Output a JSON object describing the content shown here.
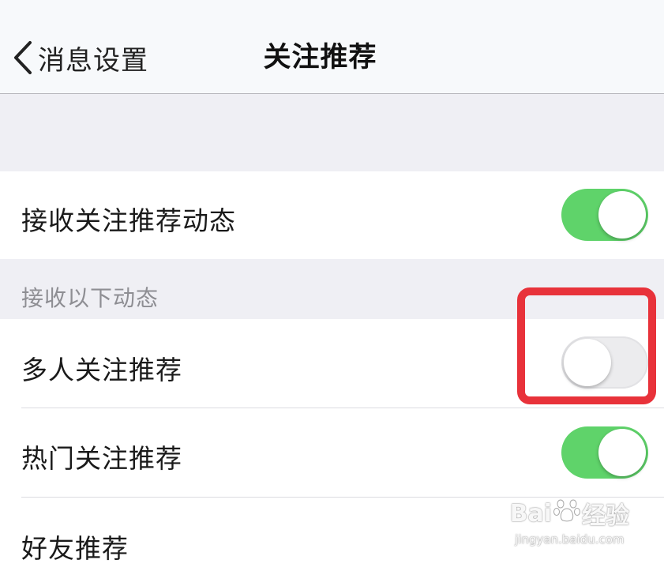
{
  "navbar": {
    "back_label": "消息设置",
    "title": "关注推荐"
  },
  "main_setting": {
    "label": "接收关注推荐动态",
    "enabled": true
  },
  "section": {
    "header": "接收以下动态",
    "items": [
      {
        "label": "多人关注推荐",
        "enabled": false
      },
      {
        "label": "热门关注推荐",
        "enabled": true
      },
      {
        "label": "好友推荐"
      }
    ]
  },
  "watermark": {
    "brand_left": "Bai",
    "brand_right": "经验",
    "url": "jingyan.baidu.com"
  },
  "colors": {
    "toggle_on": "#5fd36a",
    "toggle_off": "#ececee",
    "highlight": "#e8323a"
  }
}
